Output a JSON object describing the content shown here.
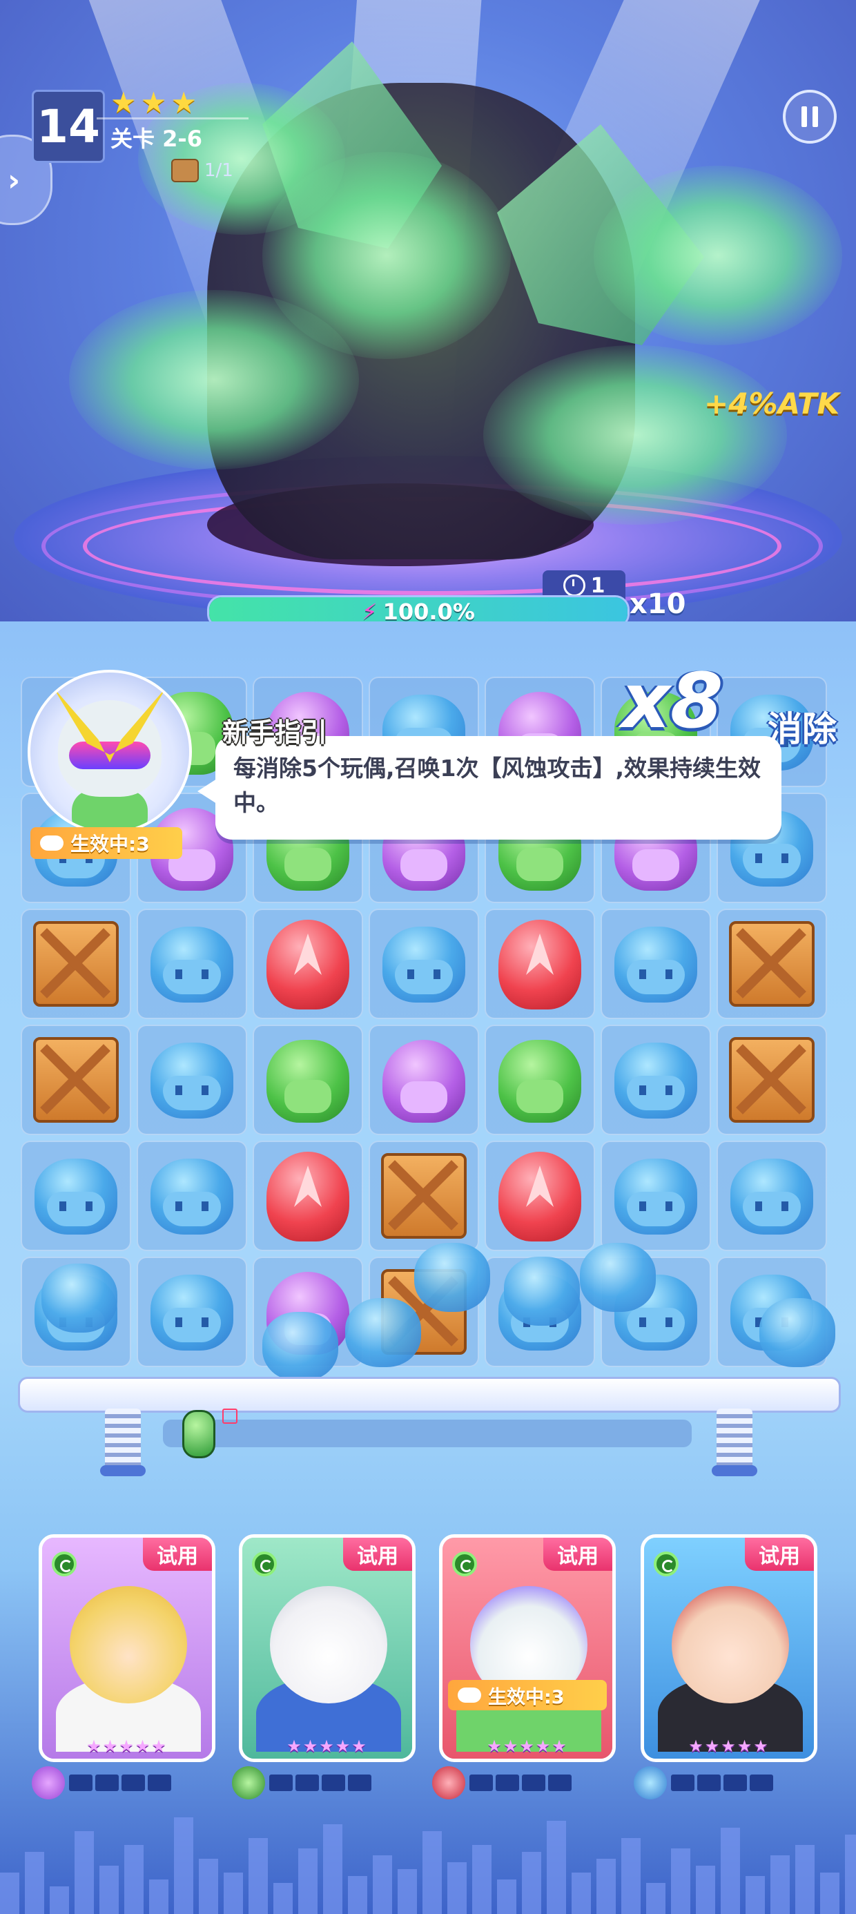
{
  "hud": {
    "level": "14",
    "stars": [
      "★",
      "★",
      "★"
    ],
    "stage_label": "关卡 2-6",
    "chest_count": "1/1",
    "buff_text": "+4%ATK"
  },
  "energy": {
    "timer": "1",
    "percent_text": "100.0%",
    "percent": 100,
    "multiplier": "x10"
  },
  "combo": {
    "count": "x8",
    "label": "消除"
  },
  "tutorial": {
    "title": "新手指引",
    "text": "每消除5个玩偶,召唤1次【风蚀攻击】,效果持续生效中。",
    "status": "生效中:3"
  },
  "board": {
    "rows": [
      [
        "blue",
        "green",
        "purple",
        "blue",
        "purple",
        "green",
        "blue"
      ],
      [
        "blue",
        "purple",
        "green",
        "purple",
        "green",
        "purple",
        "blue"
      ],
      [
        "crate",
        "blue",
        "red",
        "blue",
        "red",
        "blue",
        "crate"
      ],
      [
        "crate",
        "blue",
        "green",
        "purple",
        "green",
        "blue",
        "crate"
      ],
      [
        "blue",
        "blue",
        "red",
        "crate",
        "red",
        "blue",
        "blue"
      ],
      [
        "blue",
        "blue",
        "purple",
        "crate",
        "blue",
        "blue",
        "blue"
      ]
    ]
  },
  "heroes": [
    {
      "trial_label": "试用",
      "stars": "★★★★★",
      "status": null
    },
    {
      "trial_label": "试用",
      "stars": "★★★★★",
      "status": null
    },
    {
      "trial_label": "试用",
      "stars": "★★★★★",
      "status": "生效中:3"
    },
    {
      "trial_label": "试用",
      "stars": "★★★★★",
      "status": null
    }
  ],
  "colors": {
    "blue_piece": "#4aa9ea",
    "red_piece": "#f0434f",
    "green_piece": "#4dc247",
    "purple_piece": "#b45fe6",
    "trial_badge": "#e9336d",
    "energy_fill": "#44e3a8"
  }
}
